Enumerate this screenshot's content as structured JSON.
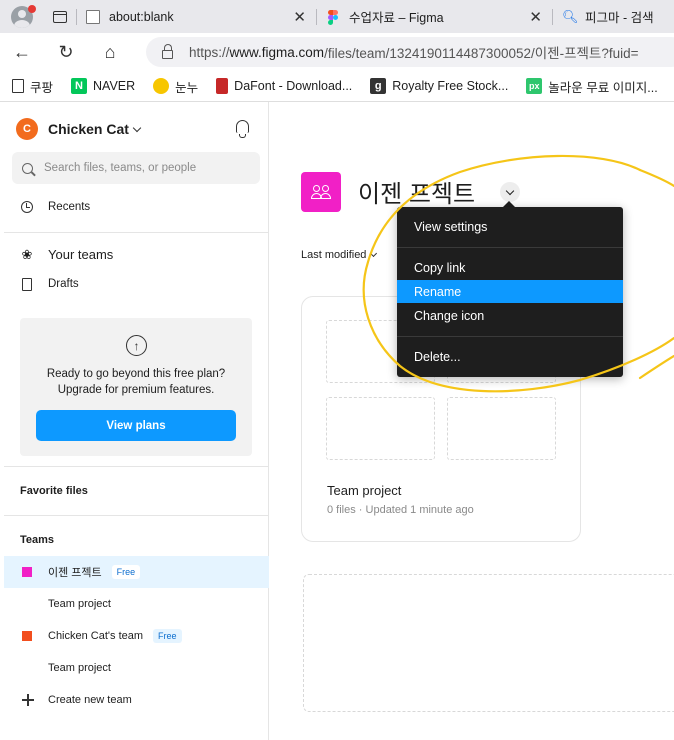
{
  "browser": {
    "tabs": [
      {
        "title": "about:blank",
        "close": "✕"
      },
      {
        "title": "수업자료 – Figma",
        "close": "✕"
      },
      {
        "title": "피그마 - 검색"
      }
    ],
    "url_prefix": "https://",
    "url_host": "www.figma.com",
    "url_path": "/files/team/1324190114487300052/이젠-프젝트?fuid=",
    "bookmarks": [
      {
        "label": "쿠팡",
        "icon": "coupang-icon"
      },
      {
        "label": "NAVER",
        "icon": "naver-icon"
      },
      {
        "label": "눈누",
        "icon": "noonnu-icon"
      },
      {
        "label": "DaFont - Download...",
        "icon": "dafont-icon"
      },
      {
        "label": "Royalty Free Stock...",
        "icon": "getty-icon"
      },
      {
        "label": "놀라운 무료 이미지...",
        "icon": "pixabay-icon"
      }
    ]
  },
  "sidebar": {
    "team_initial": "C",
    "team_name": "Chicken Cat",
    "search_placeholder": "Search files, teams, or people",
    "recents": "Recents",
    "your_teams": "Your teams",
    "drafts": "Drafts",
    "upgrade_text_1": "Ready to go beyond this free plan?",
    "upgrade_text_2": "Upgrade for premium features.",
    "view_plans": "View plans",
    "favorite_files": "Favorite files",
    "teams_title": "Teams",
    "teams": [
      {
        "name": "이젠 프젝트",
        "badge": "Free",
        "color": "#f120c6",
        "project": "Team project"
      },
      {
        "name": "Chicken Cat's team",
        "badge": "Free",
        "color": "#f24e1e",
        "project": "Team project"
      }
    ],
    "create_team": "Create new team"
  },
  "main": {
    "project_title": "이젠 프젝트",
    "sort_label": "Last modified",
    "card_title": "Team project",
    "card_subtitle": "0 files · Updated 1 minute ago"
  },
  "menu": {
    "items": [
      "View settings",
      "Copy link",
      "Rename",
      "Change icon",
      "Delete..."
    ],
    "highlighted": "Rename"
  },
  "colors": {
    "accent": "#0d99ff",
    "project_pink": "#f120c6",
    "team_orange": "#f24e1e",
    "annotation_yellow": "#f5c518"
  }
}
